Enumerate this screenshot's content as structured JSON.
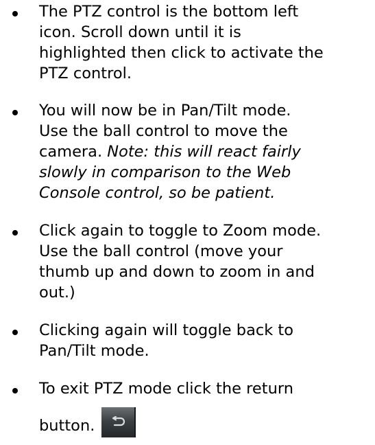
{
  "bullets": [
    {
      "lines": [
        "The PTZ control is the bottom left",
        "icon. Scroll down until it is",
        "highlighted then click to activate the",
        "PTZ control."
      ]
    },
    {
      "lines": [
        "You will now be in Pan/Tilt mode.",
        "Use the ball control to move the"
      ],
      "mixed_line_plain": "camera. ",
      "mixed_line_italic": "Note: this will react fairly",
      "italic_lines": [
        "slowly in comparison to the Web",
        "Console control, so be patient."
      ]
    },
    {
      "lines": [
        "Click again to toggle to Zoom mode.",
        "Use the ball control (move your",
        "thumb up and down to zoom in and",
        "out.)"
      ]
    },
    {
      "lines": [
        "Clicking again will toggle back to",
        "Pan/Tilt mode."
      ]
    },
    {
      "lines": [
        "To exit PTZ mode click the return"
      ],
      "last_line": "button."
    }
  ],
  "icons": {
    "return_button": "return-arrow-icon"
  }
}
